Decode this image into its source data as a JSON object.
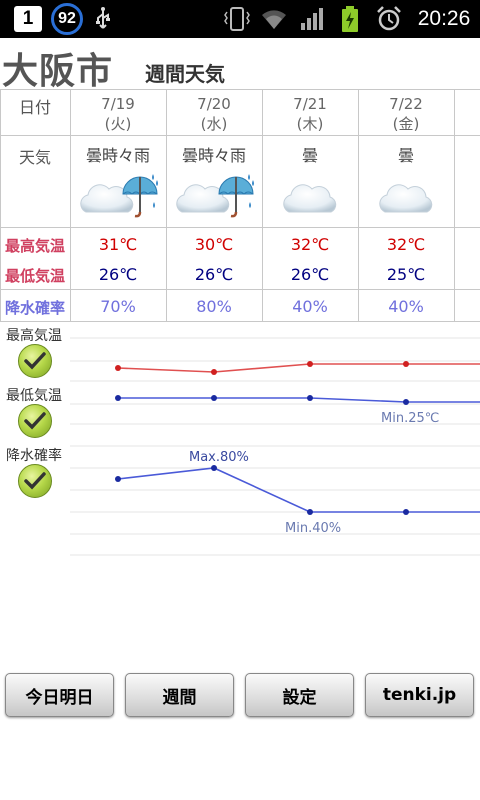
{
  "status_bar": {
    "notification_count": "1",
    "battery_level": "92",
    "time": "20:26"
  },
  "header": {
    "city": "大阪市",
    "subtitle": "週間天気"
  },
  "table": {
    "row_labels": {
      "date": "日付",
      "weather": "天気",
      "high": "最高気温",
      "low": "最低気温",
      "rain": "降水確率"
    },
    "days": [
      {
        "date": "7/19",
        "weekday": "(火)",
        "weather": "曇時々雨",
        "icon": "cloud-umbrella-icon",
        "high": "31℃",
        "low": "26℃",
        "rain": "70%"
      },
      {
        "date": "7/20",
        "weekday": "(水)",
        "weather": "曇時々雨",
        "icon": "cloud-umbrella-icon",
        "high": "30℃",
        "low": "26℃",
        "rain": "80%"
      },
      {
        "date": "7/21",
        "weekday": "(木)",
        "weather": "曇",
        "icon": "cloud-icon",
        "high": "32℃",
        "low": "26℃",
        "rain": "40%"
      },
      {
        "date": "7/22",
        "weekday": "(金)",
        "weather": "曇",
        "icon": "cloud-icon",
        "high": "32℃",
        "low": "25℃",
        "rain": "40%"
      }
    ]
  },
  "graph": {
    "toggles": [
      {
        "label": "最高気温",
        "checked": true
      },
      {
        "label": "最低気温",
        "checked": true
      },
      {
        "label": "降水確率",
        "checked": true
      }
    ],
    "annotations": {
      "low_min": "Min.25℃",
      "rain_max": "Max.80%",
      "rain_min": "Min.40%"
    },
    "colors": {
      "high": "#e05050",
      "low": "#4a5ad8",
      "rain": "#4a5ad8"
    }
  },
  "chart_data": {
    "type": "line",
    "x": [
      "7/19",
      "7/20",
      "7/21",
      "7/22"
    ],
    "series": [
      {
        "name": "最高気温",
        "values": [
          31,
          30,
          32,
          32
        ]
      },
      {
        "name": "最低気温",
        "values": [
          26,
          26,
          26,
          25
        ]
      },
      {
        "name": "降水確率",
        "values": [
          70,
          80,
          40,
          40
        ]
      }
    ]
  },
  "buttons": {
    "today_tomorrow": "今日明日",
    "weekly": "週間",
    "settings": "設定",
    "site": "tenki.jp"
  }
}
